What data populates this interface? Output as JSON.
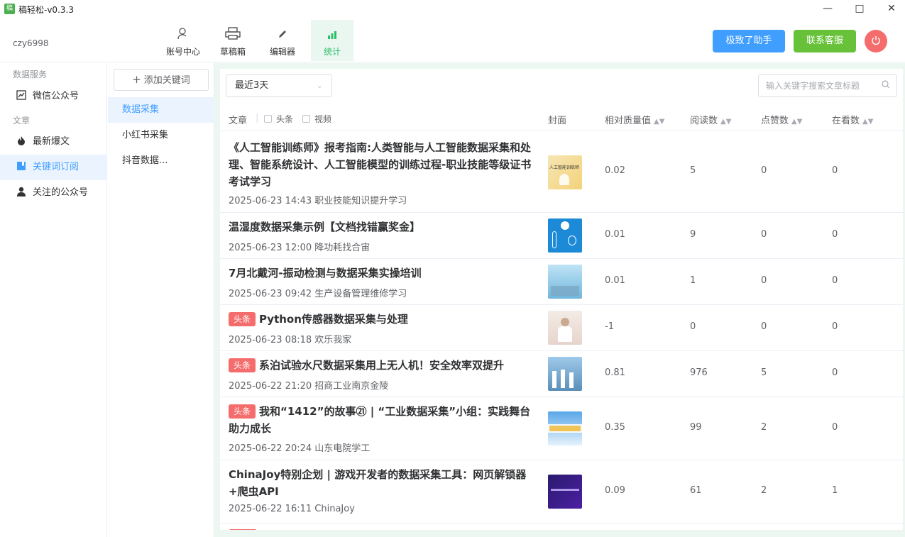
{
  "app": {
    "title": "稿轻松-v0.3.3",
    "icon_text": "稿"
  },
  "window": {
    "minimize_icon": "minimize-icon",
    "maximize_icon": "maximize-icon",
    "close_icon": "close-icon"
  },
  "header": {
    "username": "czy6998",
    "tabs": [
      {
        "label": "账号中心",
        "icon": "user-icon"
      },
      {
        "label": "草稿箱",
        "icon": "printer-icon"
      },
      {
        "label": "编辑器",
        "icon": "pen-icon"
      },
      {
        "label": "统计",
        "icon": "bar-chart-icon"
      }
    ],
    "assistant_button": "极致了助手",
    "support_button": "联系客服",
    "accent_blue": "#409eff",
    "accent_green": "#67c23a",
    "danger": "#f56c6c"
  },
  "sidebar": {
    "group_data": "数据服务",
    "wechat": "微信公众号",
    "group_article": "文章",
    "hot": "最新爆文",
    "keyword_sub": "关键词订阅",
    "followed": "关注的公众号"
  },
  "subnav": {
    "add_button": "添加关键词",
    "items": [
      "数据采集",
      "小红书采集",
      "抖音数据..."
    ]
  },
  "toolbar": {
    "range": "最近3天",
    "search_placeholder": "输入关键字搜索文章标题"
  },
  "table": {
    "headers": {
      "article": "文章",
      "toutiao": "头条",
      "video": "视频",
      "cover": "封面",
      "quality": "相对质量值",
      "reads": "阅读数",
      "likes": "点赞数",
      "watching": "在看数"
    },
    "tag_label": "头条",
    "rows": [
      {
        "title": "《人工智能训练师》报考指南:人类智能与人工智能数据采集和处理、智能系统设计、人工智能模型的训练过程-职业技能等级证书考试学习",
        "meta": "2025-06-23 14:43 职业技能知识提升学习",
        "quality": "0.02",
        "reads": "5",
        "likes": "0",
        "watching": "0"
      },
      {
        "title": "温湿度数据采集示例【文档找错赢奖金】",
        "meta": "2025-06-23 12:00 降功耗找合宙",
        "quality": "0.01",
        "reads": "9",
        "likes": "0",
        "watching": "0"
      },
      {
        "title": "7月北戴河-振动检测与数据采集实操培训",
        "meta": "2025-06-23 09:42 生产设备管理维修学习",
        "quality": "0.01",
        "reads": "1",
        "likes": "0",
        "watching": "0"
      },
      {
        "title": "Python传感器数据采集与处理",
        "meta": "2025-06-23 08:18 欢乐我家",
        "quality": "-1",
        "reads": "0",
        "likes": "0",
        "watching": "0",
        "tag": true
      },
      {
        "title": "系泊试验水尺数据采集用上无人机！安全效率双提升",
        "meta": "2025-06-22 21:20 招商工业南京金陵",
        "quality": "0.81",
        "reads": "976",
        "likes": "5",
        "watching": "0",
        "tag": true
      },
      {
        "title": "我和“1412”的故事㉑ | “工业数据采集”小组：实践舞台 助力成长",
        "meta": "2025-06-22 20:24 山东电院学工",
        "quality": "0.35",
        "reads": "99",
        "likes": "2",
        "watching": "0",
        "tag": true
      },
      {
        "title": "ChinaJoy特别企划 | 游戏开发者的数据采集工具：网页解锁器+爬虫API",
        "meta": "2025-06-22 16:11 ChinaJoy",
        "quality": "0.09",
        "reads": "61",
        "likes": "2",
        "watching": "1"
      }
    ]
  }
}
